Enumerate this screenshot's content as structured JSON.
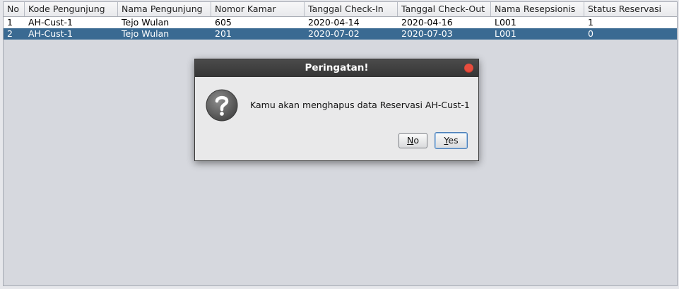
{
  "table": {
    "columns": [
      "No",
      "Kode Pengunjung",
      "Nama Pengunjung",
      "Nomor Kamar",
      "Tanggal Check-In",
      "Tanggal Check-Out",
      "Nama Resepsionis",
      "Status Reservasi"
    ],
    "rows": [
      [
        "1",
        "AH-Cust-1",
        "Tejo Wulan",
        "605",
        "2020-04-14",
        "2020-04-16",
        "L001",
        "1"
      ],
      [
        "2",
        "AH-Cust-1",
        "Tejo Wulan",
        "201",
        "2020-07-02",
        "2020-07-03",
        "L001",
        "0"
      ]
    ],
    "selected_row": 2
  },
  "dialog": {
    "title": "Peringatan!",
    "icon": "question-icon",
    "message": "Kamu akan menghapus data Reservasi AH-Cust-1",
    "no_label_mnemonic": "N",
    "no_label_rest": "o",
    "yes_label_mnemonic": "Y",
    "yes_label_rest": "es"
  },
  "colors": {
    "selection": "#3a6a92",
    "titlebar": "#3d3d3d",
    "close": "#e84c3d"
  }
}
